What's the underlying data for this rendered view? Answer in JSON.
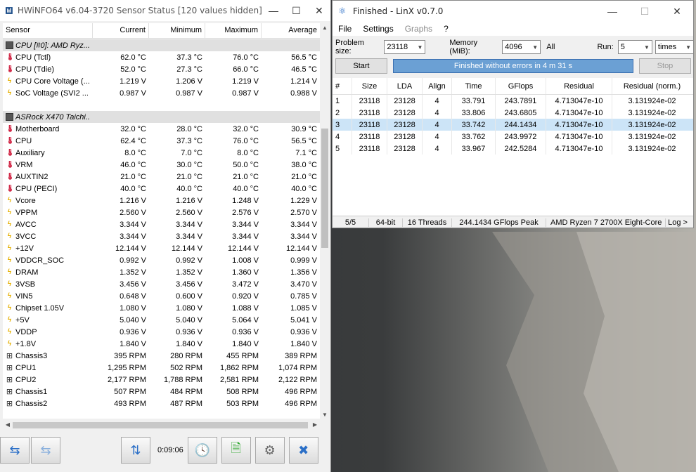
{
  "hwinfo": {
    "title": "HWiNFO64 v6.04-3720 Sensor Status [120 values hidden]",
    "columns": [
      "Sensor",
      "Current",
      "Minimum",
      "Maximum",
      "Average"
    ],
    "groups": [
      {
        "name": "CPU [#0]: AMD Ryz...",
        "rows": [
          {
            "icon": "thermometer-icon",
            "name": "CPU (Tctl)",
            "cur": "62.0 °C",
            "min": "37.3 °C",
            "max": "76.0 °C",
            "avg": "56.5 °C"
          },
          {
            "icon": "thermometer-icon",
            "name": "CPU (Tdie)",
            "cur": "52.0 °C",
            "min": "27.3 °C",
            "max": "66.0 °C",
            "avg": "46.5 °C"
          },
          {
            "icon": "voltage-icon",
            "name": "CPU Core Voltage (...",
            "cur": "1.219 V",
            "min": "1.206 V",
            "max": "1.219 V",
            "avg": "1.214 V"
          },
          {
            "icon": "voltage-icon",
            "name": "SoC Voltage (SVI2 ...",
            "cur": "0.987 V",
            "min": "0.987 V",
            "max": "0.987 V",
            "avg": "0.988 V"
          }
        ]
      },
      {
        "name": "ASRock X470 Taichi...",
        "rows": [
          {
            "icon": "thermometer-icon",
            "name": "Motherboard",
            "cur": "32.0 °C",
            "min": "28.0 °C",
            "max": "32.0 °C",
            "avg": "30.9 °C"
          },
          {
            "icon": "thermometer-icon",
            "name": "CPU",
            "cur": "62.4 °C",
            "min": "37.3 °C",
            "max": "76.0 °C",
            "avg": "56.5 °C"
          },
          {
            "icon": "thermometer-icon",
            "name": "Auxiliary",
            "cur": "8.0 °C",
            "min": "7.0 °C",
            "max": "8.0 °C",
            "avg": "7.1 °C"
          },
          {
            "icon": "thermometer-icon",
            "name": "VRM",
            "cur": "46.0 °C",
            "min": "30.0 °C",
            "max": "50.0 °C",
            "avg": "38.0 °C"
          },
          {
            "icon": "thermometer-icon",
            "name": "AUXTIN2",
            "cur": "21.0 °C",
            "min": "21.0 °C",
            "max": "21.0 °C",
            "avg": "21.0 °C"
          },
          {
            "icon": "thermometer-icon",
            "name": "CPU (PECI)",
            "cur": "40.0 °C",
            "min": "40.0 °C",
            "max": "40.0 °C",
            "avg": "40.0 °C"
          },
          {
            "icon": "voltage-icon",
            "name": "Vcore",
            "cur": "1.216 V",
            "min": "1.216 V",
            "max": "1.248 V",
            "avg": "1.229 V"
          },
          {
            "icon": "voltage-icon",
            "name": "VPPM",
            "cur": "2.560 V",
            "min": "2.560 V",
            "max": "2.576 V",
            "avg": "2.570 V"
          },
          {
            "icon": "voltage-icon",
            "name": "AVCC",
            "cur": "3.344 V",
            "min": "3.344 V",
            "max": "3.344 V",
            "avg": "3.344 V"
          },
          {
            "icon": "voltage-icon",
            "name": "3VCC",
            "cur": "3.344 V",
            "min": "3.344 V",
            "max": "3.344 V",
            "avg": "3.344 V"
          },
          {
            "icon": "voltage-icon",
            "name": "+12V",
            "cur": "12.144 V",
            "min": "12.144 V",
            "max": "12.144 V",
            "avg": "12.144 V"
          },
          {
            "icon": "voltage-icon",
            "name": "VDDCR_SOC",
            "cur": "0.992 V",
            "min": "0.992 V",
            "max": "1.008 V",
            "avg": "0.999 V"
          },
          {
            "icon": "voltage-icon",
            "name": "DRAM",
            "cur": "1.352 V",
            "min": "1.352 V",
            "max": "1.360 V",
            "avg": "1.356 V"
          },
          {
            "icon": "voltage-icon",
            "name": "3VSB",
            "cur": "3.456 V",
            "min": "3.456 V",
            "max": "3.472 V",
            "avg": "3.470 V"
          },
          {
            "icon": "voltage-icon",
            "name": "VIN5",
            "cur": "0.648 V",
            "min": "0.600 V",
            "max": "0.920 V",
            "avg": "0.785 V"
          },
          {
            "icon": "voltage-icon",
            "name": "Chipset 1.05V",
            "cur": "1.080 V",
            "min": "1.080 V",
            "max": "1.088 V",
            "avg": "1.085 V"
          },
          {
            "icon": "voltage-icon",
            "name": "+5V",
            "cur": "5.040 V",
            "min": "5.040 V",
            "max": "5.064 V",
            "avg": "5.041 V"
          },
          {
            "icon": "voltage-icon",
            "name": "VDDP",
            "cur": "0.936 V",
            "min": "0.936 V",
            "max": "0.936 V",
            "avg": "0.936 V"
          },
          {
            "icon": "voltage-icon",
            "name": "+1.8V",
            "cur": "1.840 V",
            "min": "1.840 V",
            "max": "1.840 V",
            "avg": "1.840 V"
          },
          {
            "icon": "fan-icon",
            "name": "Chassis3",
            "cur": "395 RPM",
            "min": "280 RPM",
            "max": "455 RPM",
            "avg": "389 RPM"
          },
          {
            "icon": "fan-icon",
            "name": "CPU1",
            "cur": "1,295 RPM",
            "min": "502 RPM",
            "max": "1,862 RPM",
            "avg": "1,074 RPM"
          },
          {
            "icon": "fan-icon",
            "name": "CPU2",
            "cur": "2,177 RPM",
            "min": "1,788 RPM",
            "max": "2,581 RPM",
            "avg": "2,122 RPM"
          },
          {
            "icon": "fan-icon",
            "name": "Chassis1",
            "cur": "507 RPM",
            "min": "484 RPM",
            "max": "508 RPM",
            "avg": "496 RPM"
          },
          {
            "icon": "fan-icon",
            "name": "Chassis2",
            "cur": "493 RPM",
            "min": "487 RPM",
            "max": "503 RPM",
            "avg": "496 RPM"
          }
        ]
      }
    ],
    "timer": "0:09:06",
    "toolbar_icons": [
      "nav-arrows-icon",
      "nav-arrows-disabled-icon",
      "network-icon",
      "clock-icon",
      "report-icon",
      "settings-gear-icon",
      "close-x-icon"
    ]
  },
  "linx": {
    "title": "Finished - LinX v0.7.0",
    "menu": [
      "File",
      "Settings",
      "Graphs",
      "?"
    ],
    "problem_size_label": "Problem size:",
    "problem_size_value": "23118",
    "memory_label": "Memory (MiB):",
    "memory_value": "4096",
    "all_label": "All",
    "run_label": "Run:",
    "run_value": "5",
    "run_unit": "times",
    "start_label": "Start",
    "status_text": "Finished without errors in 4 m 31 s",
    "stop_label": "Stop",
    "columns": [
      "#",
      "Size",
      "LDA",
      "Align",
      "Time",
      "GFlops",
      "Residual",
      "Residual (norm.)"
    ],
    "rows": [
      [
        "1",
        "23118",
        "23128",
        "4",
        "33.791",
        "243.7891",
        "4.713047e-10",
        "3.131924e-02"
      ],
      [
        "2",
        "23118",
        "23128",
        "4",
        "33.806",
        "243.6805",
        "4.713047e-10",
        "3.131924e-02"
      ],
      [
        "3",
        "23118",
        "23128",
        "4",
        "33.742",
        "244.1434",
        "4.713047e-10",
        "3.131924e-02"
      ],
      [
        "4",
        "23118",
        "23128",
        "4",
        "33.762",
        "243.9972",
        "4.713047e-10",
        "3.131924e-02"
      ],
      [
        "5",
        "23118",
        "23128",
        "4",
        "33.967",
        "242.5284",
        "4.713047e-10",
        "3.131924e-02"
      ]
    ],
    "selected_row": 2,
    "footer": [
      "5/5",
      "64-bit",
      "16 Threads",
      "244.1434 GFlops Peak",
      "AMD Ryzen 7 2700X Eight-Core",
      "Log >"
    ]
  }
}
